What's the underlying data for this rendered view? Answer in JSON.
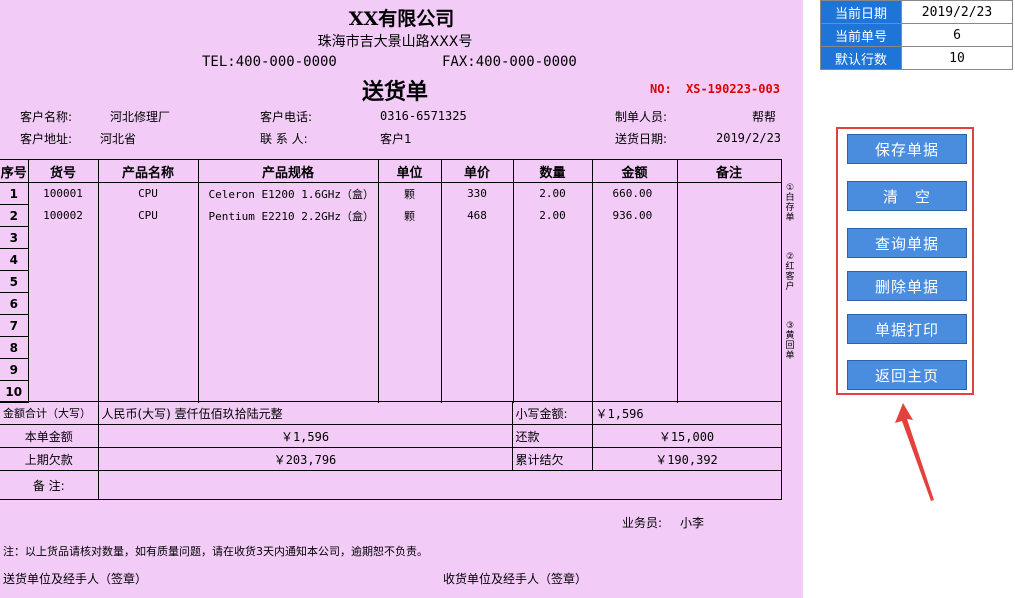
{
  "header": {
    "company": "XX有限公司",
    "address": "珠海市吉大景山路XXX号",
    "tel": "TEL:400-000-0000",
    "fax": "FAX:400-000-0000",
    "doc_title": "送货单",
    "no_label": "NO:",
    "no_value": "XS-190223-003"
  },
  "customer": {
    "name_label": "客户名称:",
    "name": "河北修理厂",
    "phone_label": "客户电话:",
    "phone": "0316-6571325",
    "maker_label": "制单人员:",
    "maker": "帮帮",
    "addr_label": "客户地址:",
    "addr": "河北省",
    "contact_label": "联 系 人:",
    "contact": "客户1",
    "date_label": "送货日期:",
    "date": "2019/2/23"
  },
  "table": {
    "headers": [
      "序号",
      "货号",
      "产品名称",
      "产品规格",
      "单位",
      "单价",
      "数量",
      "金额",
      "备注"
    ],
    "rows": [
      {
        "seq": "1",
        "code": "100001",
        "name": "CPU",
        "spec": "Celeron E1200 1.6GHz（盒）",
        "unit": "颗",
        "price": "330",
        "qty": "2.00",
        "amount": "660.00",
        "note": ""
      },
      {
        "seq": "2",
        "code": "100002",
        "name": "CPU",
        "spec": "Pentium E2210 2.2GHz（盒）",
        "unit": "颗",
        "price": "468",
        "qty": "2.00",
        "amount": "936.00",
        "note": ""
      },
      {
        "seq": "3"
      },
      {
        "seq": "4"
      },
      {
        "seq": "5"
      },
      {
        "seq": "6"
      },
      {
        "seq": "7"
      },
      {
        "seq": "8"
      },
      {
        "seq": "9"
      },
      {
        "seq": "10"
      }
    ]
  },
  "summary": {
    "total_label": "金额合计（大写）",
    "total_words": "人民币(大写) 壹仟伍佰玖拾陆元整",
    "small_label": "小写金额:",
    "small_value": "￥1,596",
    "current_label": "本单金额",
    "current_value": "￥1,596",
    "repay_label": "还款",
    "repay_value": "￥15,000",
    "prev_label": "上期欠款",
    "prev_value": "￥203,796",
    "balance_label": "累计结欠",
    "balance_value": "￥190,392",
    "remark_label": "备    注:"
  },
  "side_notes": [
    "①白存单",
    "②红客户",
    "③黄回单"
  ],
  "footer": {
    "salesman_label": "业务员:",
    "salesman": "小李",
    "note": "注：以上货品请核对数量，如有质量问题，请在收货3天内通知本公司，逾期恕不负责。",
    "sender": "送货单位及经手人（签章）",
    "receiver": "收货单位及经手人（签章）"
  },
  "info_panel": [
    {
      "label": "当前日期",
      "value": "2019/2/23"
    },
    {
      "label": "当前单号",
      "value": "6"
    },
    {
      "label": "默认行数",
      "value": "10"
    }
  ],
  "buttons": {
    "save": "保存单据",
    "clear": "清　空",
    "query": "查询单据",
    "delete": "删除单据",
    "print": "单据打印",
    "home": "返回主页"
  },
  "colors": {
    "sheet_bg": "#f2ccf7",
    "button_bg": "#4a8ddf",
    "panel_border": "#e3413d",
    "info_label_bg": "#1f74d8",
    "doc_no": "#e00000"
  }
}
